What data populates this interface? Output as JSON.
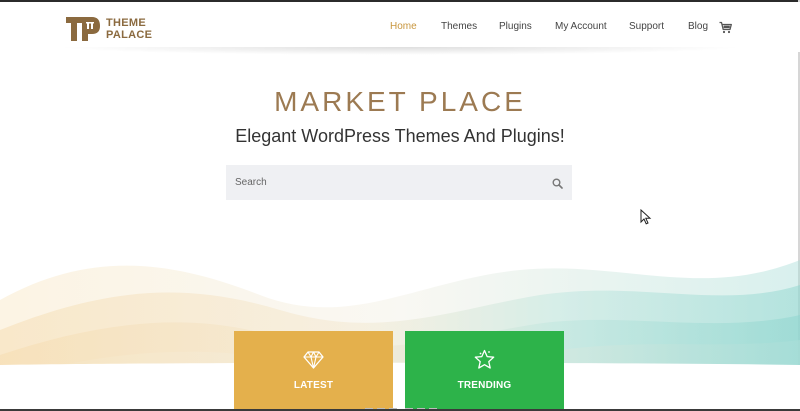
{
  "brand": {
    "line1": "THEME",
    "line2": "PALACE",
    "color": "#8b6a3f"
  },
  "nav": {
    "items": [
      {
        "label": "Home",
        "active": true
      },
      {
        "label": "Themes",
        "active": false
      },
      {
        "label": "Plugins",
        "active": false
      },
      {
        "label": "My Account",
        "active": false
      },
      {
        "label": "Support",
        "active": false
      },
      {
        "label": "Blog",
        "active": false
      }
    ],
    "cart_icon": "cart-icon",
    "active_color": "#c8963e"
  },
  "hero": {
    "title": "MARKET PLACE",
    "subtitle": "Elegant WordPress Themes And Plugins!"
  },
  "search": {
    "placeholder": "Search",
    "value": "",
    "icon": "search-icon"
  },
  "cards": [
    {
      "label": "LATEST",
      "icon": "diamond-icon",
      "color": "#e4b04c"
    },
    {
      "label": "TRENDING",
      "icon": "star-icon",
      "color": "#2db34a"
    }
  ]
}
